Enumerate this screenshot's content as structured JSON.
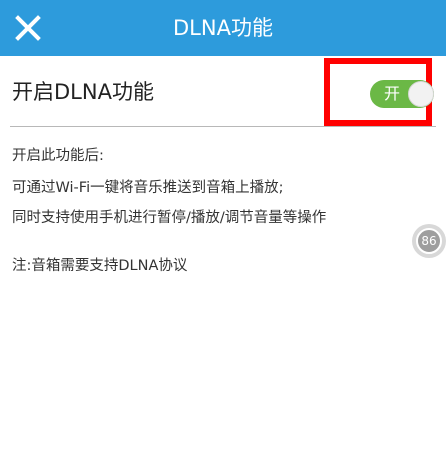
{
  "header": {
    "title": "DLNA功能",
    "background_color": "#2d9bdc",
    "close_icon": "close-icon"
  },
  "setting": {
    "label": "开启DLNA功能",
    "toggle": {
      "state": "on",
      "label": "开",
      "color": "#6bb846"
    },
    "highlight_color": "#ff0000"
  },
  "description": {
    "heading": "开启此功能后:",
    "line1": "可通过Wi-Fi一键将音乐推送到音箱上播放;",
    "line2": "同时支持使用手机进行暂停/播放/调节音量等操作",
    "note": "注:音箱需要支持DLNA协议"
  },
  "float_badge": {
    "text": "86"
  }
}
